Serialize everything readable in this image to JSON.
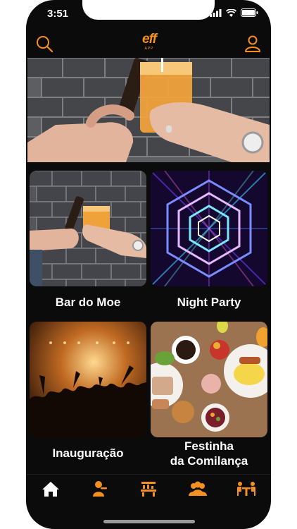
{
  "status": {
    "time": "3:51"
  },
  "header": {
    "logo_main": "eff",
    "logo_sub": "APP"
  },
  "icons": {
    "search": "search-icon",
    "profile": "user-icon",
    "home": "home-icon",
    "waiter": "waiter-icon",
    "bar": "bar-counter-icon",
    "group": "group-icon",
    "table": "table-icon"
  },
  "cards": [
    {
      "title": "Bar do Moe"
    },
    {
      "title": "Night Party"
    },
    {
      "title": "Inauguração"
    },
    {
      "title_line1": "Festinha",
      "title_line2": "da Comilança"
    }
  ],
  "colors": {
    "accent": "#f5901e",
    "background": "#0b0b0b"
  }
}
